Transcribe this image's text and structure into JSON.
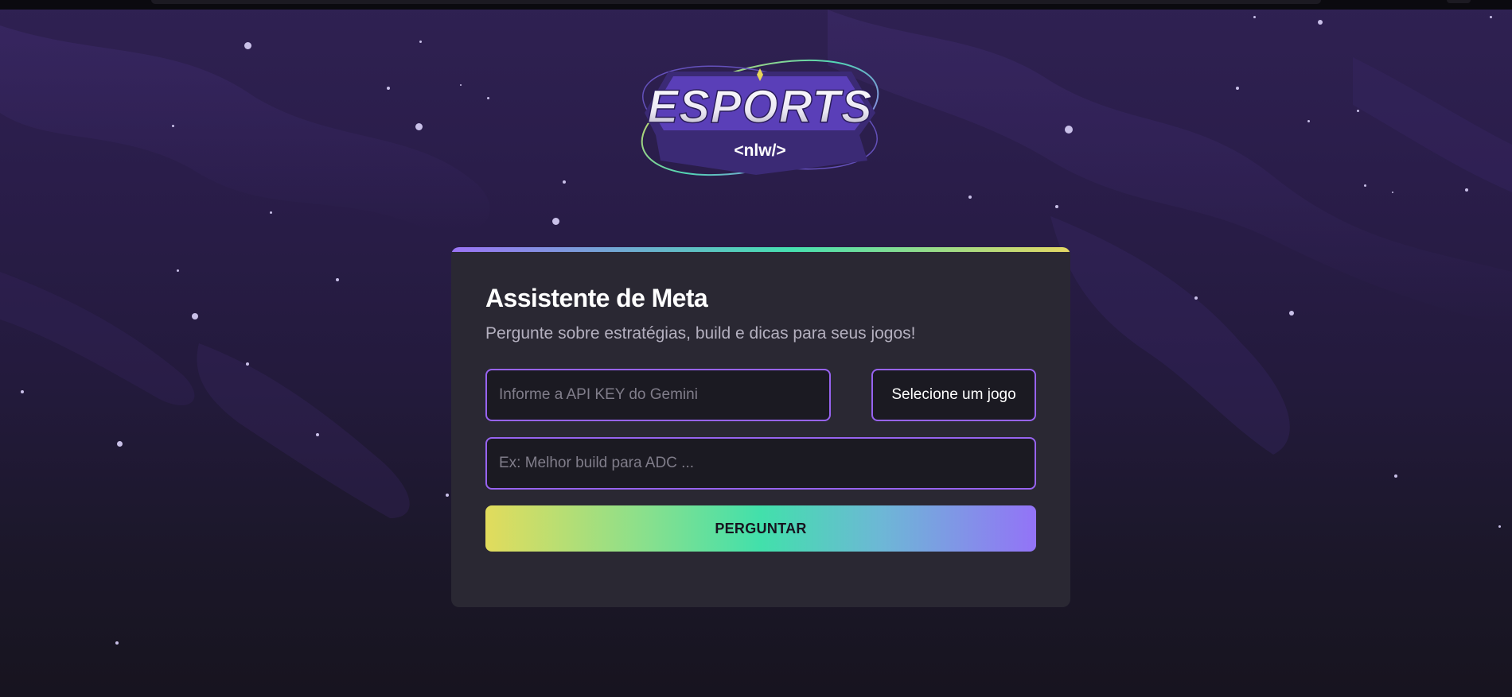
{
  "logo": {
    "text": "ESPORTS",
    "subtext": "<nlw/>"
  },
  "card": {
    "title": "Assistente de Meta",
    "subtitle": "Pergunte sobre estratégias, build e dicas para seus jogos!"
  },
  "form": {
    "api_key_placeholder": "Informe a API KEY do Gemini",
    "api_key_value": "",
    "game_select_value": "Selecione um jogo",
    "question_placeholder": "Ex: Melhor build para ADC ...",
    "question_value": "",
    "submit_label": "PERGUNTAR"
  },
  "colors": {
    "accent_purple": "#9763f0",
    "card_bg": "#2a2833",
    "gradient_yellow": "#e2dc5c",
    "gradient_green": "#42e0ab",
    "gradient_violet": "#9373f7"
  }
}
